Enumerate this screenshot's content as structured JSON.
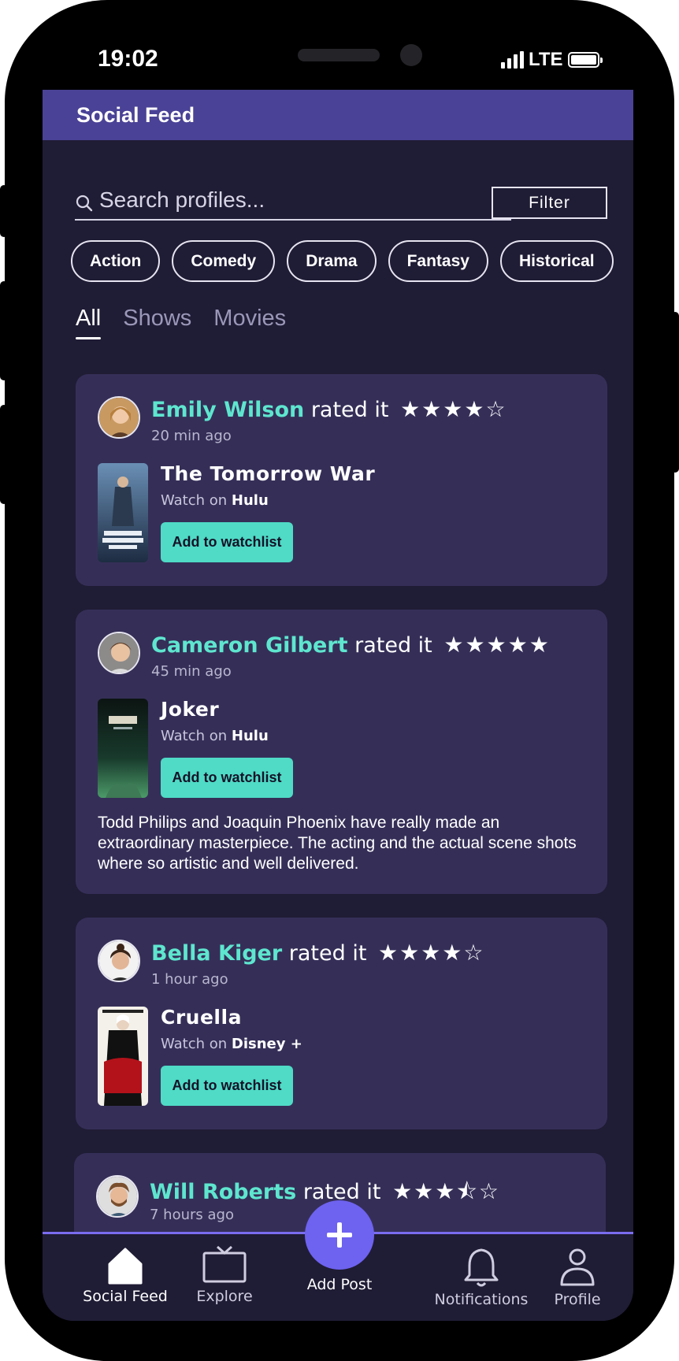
{
  "status_bar": {
    "time": "19:02",
    "network": "LTE"
  },
  "app_bar": {
    "title": "Social Feed"
  },
  "search": {
    "placeholder": "Search profiles..."
  },
  "filter": {
    "label": "Filter"
  },
  "genres": [
    "Action",
    "Comedy",
    "Drama",
    "Fantasy",
    "Historical"
  ],
  "tabs": [
    {
      "label": "All",
      "active": true
    },
    {
      "label": "Shows",
      "active": false
    },
    {
      "label": "Movies",
      "active": false
    }
  ],
  "feed": [
    {
      "user": "Emily Wilson",
      "action": "rated it",
      "rating": 4,
      "stars": "★★★★☆",
      "time": "20 min ago",
      "title": "The Tomorrow War",
      "watch_prefix": "Watch on",
      "platform": "Hulu",
      "button": "Add to watchlist",
      "review": ""
    },
    {
      "user": "Cameron Gilbert",
      "action": "rated it",
      "rating": 5,
      "stars": "★★★★★",
      "time": "45 min ago",
      "title": "Joker",
      "watch_prefix": "Watch on",
      "platform": "Hulu",
      "button": "Add to watchlist",
      "review": "Todd Philips and Joaquin Phoenix have really made an extraordinary masterpiece. The acting and the actual scene shots where so artistic and well delivered."
    },
    {
      "user": "Bella Kiger",
      "action": "rated it",
      "rating": 4,
      "stars": "★★★★☆",
      "time": "1 hour ago",
      "title": "Cruella",
      "watch_prefix": "Watch on",
      "platform": "Disney +",
      "button": "Add to watchlist",
      "review": ""
    },
    {
      "user": "Will Roberts",
      "action": "rated it",
      "rating": 3.5,
      "stars": "★★★⯪☆",
      "time": "7 hours ago"
    }
  ],
  "bottom_nav": {
    "items": [
      "Social Feed",
      "Explore",
      "Notifications",
      "Profile"
    ],
    "fab_label": "Add Post",
    "active": "Social Feed"
  },
  "colors": {
    "accent": "#5ee6cf",
    "app_bar": "#4a4296",
    "card": "#352f58",
    "background": "#1f1c35",
    "fab": "#6e62f0"
  }
}
